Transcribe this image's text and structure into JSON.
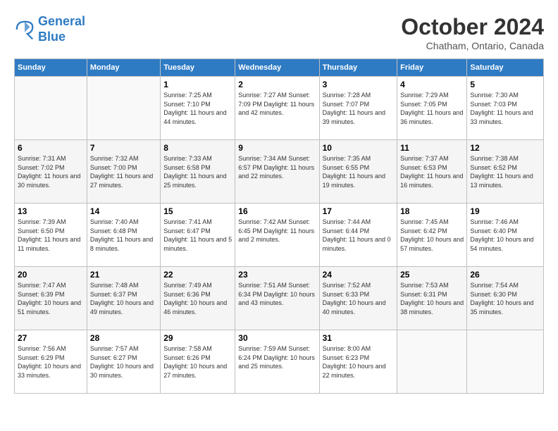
{
  "header": {
    "logo_line1": "General",
    "logo_line2": "Blue",
    "month_title": "October 2024",
    "location": "Chatham, Ontario, Canada"
  },
  "weekdays": [
    "Sunday",
    "Monday",
    "Tuesday",
    "Wednesday",
    "Thursday",
    "Friday",
    "Saturday"
  ],
  "weeks": [
    [
      {
        "day": "",
        "info": ""
      },
      {
        "day": "",
        "info": ""
      },
      {
        "day": "1",
        "info": "Sunrise: 7:25 AM\nSunset: 7:10 PM\nDaylight: 11 hours and 44 minutes."
      },
      {
        "day": "2",
        "info": "Sunrise: 7:27 AM\nSunset: 7:09 PM\nDaylight: 11 hours and 42 minutes."
      },
      {
        "day": "3",
        "info": "Sunrise: 7:28 AM\nSunset: 7:07 PM\nDaylight: 11 hours and 39 minutes."
      },
      {
        "day": "4",
        "info": "Sunrise: 7:29 AM\nSunset: 7:05 PM\nDaylight: 11 hours and 36 minutes."
      },
      {
        "day": "5",
        "info": "Sunrise: 7:30 AM\nSunset: 7:03 PM\nDaylight: 11 hours and 33 minutes."
      }
    ],
    [
      {
        "day": "6",
        "info": "Sunrise: 7:31 AM\nSunset: 7:02 PM\nDaylight: 11 hours and 30 minutes."
      },
      {
        "day": "7",
        "info": "Sunrise: 7:32 AM\nSunset: 7:00 PM\nDaylight: 11 hours and 27 minutes."
      },
      {
        "day": "8",
        "info": "Sunrise: 7:33 AM\nSunset: 6:58 PM\nDaylight: 11 hours and 25 minutes."
      },
      {
        "day": "9",
        "info": "Sunrise: 7:34 AM\nSunset: 6:57 PM\nDaylight: 11 hours and 22 minutes."
      },
      {
        "day": "10",
        "info": "Sunrise: 7:35 AM\nSunset: 6:55 PM\nDaylight: 11 hours and 19 minutes."
      },
      {
        "day": "11",
        "info": "Sunrise: 7:37 AM\nSunset: 6:53 PM\nDaylight: 11 hours and 16 minutes."
      },
      {
        "day": "12",
        "info": "Sunrise: 7:38 AM\nSunset: 6:52 PM\nDaylight: 11 hours and 13 minutes."
      }
    ],
    [
      {
        "day": "13",
        "info": "Sunrise: 7:39 AM\nSunset: 6:50 PM\nDaylight: 11 hours and 11 minutes."
      },
      {
        "day": "14",
        "info": "Sunrise: 7:40 AM\nSunset: 6:48 PM\nDaylight: 11 hours and 8 minutes."
      },
      {
        "day": "15",
        "info": "Sunrise: 7:41 AM\nSunset: 6:47 PM\nDaylight: 11 hours and 5 minutes."
      },
      {
        "day": "16",
        "info": "Sunrise: 7:42 AM\nSunset: 6:45 PM\nDaylight: 11 hours and 2 minutes."
      },
      {
        "day": "17",
        "info": "Sunrise: 7:44 AM\nSunset: 6:44 PM\nDaylight: 11 hours and 0 minutes."
      },
      {
        "day": "18",
        "info": "Sunrise: 7:45 AM\nSunset: 6:42 PM\nDaylight: 10 hours and 57 minutes."
      },
      {
        "day": "19",
        "info": "Sunrise: 7:46 AM\nSunset: 6:40 PM\nDaylight: 10 hours and 54 minutes."
      }
    ],
    [
      {
        "day": "20",
        "info": "Sunrise: 7:47 AM\nSunset: 6:39 PM\nDaylight: 10 hours and 51 minutes."
      },
      {
        "day": "21",
        "info": "Sunrise: 7:48 AM\nSunset: 6:37 PM\nDaylight: 10 hours and 49 minutes."
      },
      {
        "day": "22",
        "info": "Sunrise: 7:49 AM\nSunset: 6:36 PM\nDaylight: 10 hours and 46 minutes."
      },
      {
        "day": "23",
        "info": "Sunrise: 7:51 AM\nSunset: 6:34 PM\nDaylight: 10 hours and 43 minutes."
      },
      {
        "day": "24",
        "info": "Sunrise: 7:52 AM\nSunset: 6:33 PM\nDaylight: 10 hours and 40 minutes."
      },
      {
        "day": "25",
        "info": "Sunrise: 7:53 AM\nSunset: 6:31 PM\nDaylight: 10 hours and 38 minutes."
      },
      {
        "day": "26",
        "info": "Sunrise: 7:54 AM\nSunset: 6:30 PM\nDaylight: 10 hours and 35 minutes."
      }
    ],
    [
      {
        "day": "27",
        "info": "Sunrise: 7:56 AM\nSunset: 6:29 PM\nDaylight: 10 hours and 33 minutes."
      },
      {
        "day": "28",
        "info": "Sunrise: 7:57 AM\nSunset: 6:27 PM\nDaylight: 10 hours and 30 minutes."
      },
      {
        "day": "29",
        "info": "Sunrise: 7:58 AM\nSunset: 6:26 PM\nDaylight: 10 hours and 27 minutes."
      },
      {
        "day": "30",
        "info": "Sunrise: 7:59 AM\nSunset: 6:24 PM\nDaylight: 10 hours and 25 minutes."
      },
      {
        "day": "31",
        "info": "Sunrise: 8:00 AM\nSunset: 6:23 PM\nDaylight: 10 hours and 22 minutes."
      },
      {
        "day": "",
        "info": ""
      },
      {
        "day": "",
        "info": ""
      }
    ]
  ]
}
